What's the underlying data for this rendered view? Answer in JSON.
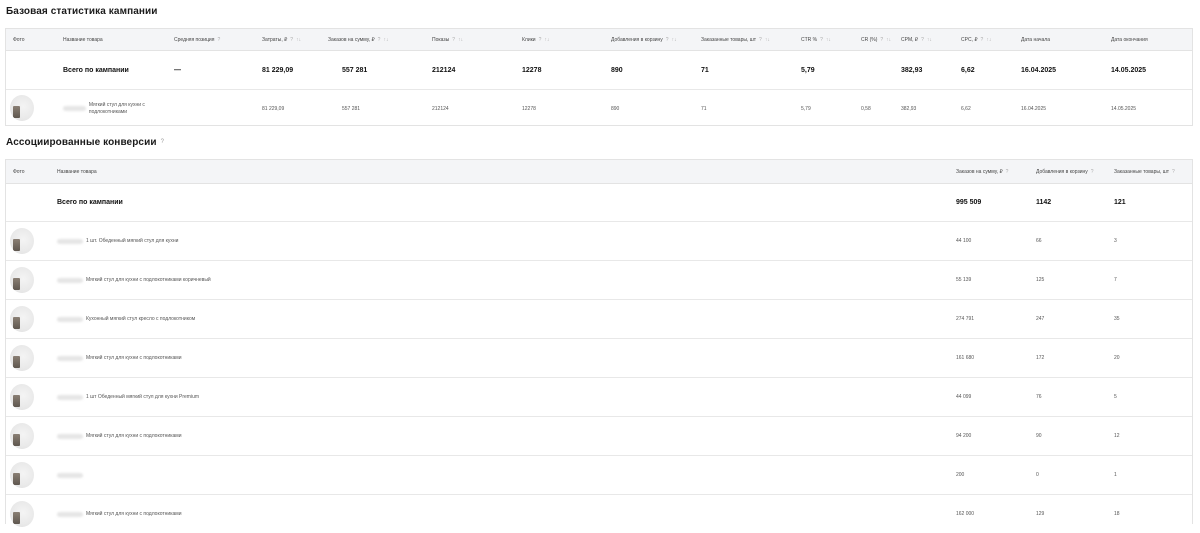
{
  "base": {
    "title": "Базовая статистика кампании",
    "headers": {
      "photo": "Фото",
      "name": "Название товара",
      "avg_pos": "Средняя позиция",
      "cost": "Затраты, ₽",
      "orders_sum": "Заказов на сумму, ₽",
      "shows": "Показы",
      "clicks": "Клики",
      "cart": "Добавления в корзину",
      "ordered": "Заказанные товары, шт",
      "ctr": "CTR %",
      "cr": "CR (%)",
      "cpm": "CPM, ₽",
      "cpc": "CPC, ₽",
      "start": "Дата начала",
      "end": "Дата окончания"
    },
    "total": {
      "name": "Всего по кампании",
      "avg_pos": "—",
      "cost": "81 229,09",
      "orders_sum": "557 281",
      "shows": "212124",
      "clicks": "12278",
      "cart": "890",
      "ordered": "71",
      "ctr": "5,79",
      "cr": "",
      "cpm": "382,93",
      "cpc": "6,62",
      "start": "16.04.2025",
      "end": "14.05.2025"
    },
    "item": {
      "name": "Мягкий стул для кухни с подлокотниками",
      "cost": "81 229,09",
      "orders_sum": "557 281",
      "shows": "212124",
      "clicks": "12278",
      "cart": "890",
      "ordered": "71",
      "ctr": "5,79",
      "cr": "0,58",
      "cpm": "382,93",
      "cpc": "6,62",
      "start": "16.04.2025",
      "end": "14.05.2025"
    }
  },
  "assoc": {
    "title": "Ассоциированные конверсии",
    "headers": {
      "photo": "Фото",
      "name": "Название товара",
      "orders_sum": "Заказов на сумму, ₽",
      "cart": "Добавления в корзину",
      "ordered": "Заказанные товары, шт"
    },
    "total": {
      "name": "Всего по кампании",
      "orders_sum": "995 509",
      "cart": "1142",
      "ordered": "121"
    },
    "rows": [
      {
        "name": "1 шт. Обеденный мягкий стул для кухни",
        "orders_sum": "44 100",
        "cart": "66",
        "ordered": "3"
      },
      {
        "name": "Мягкий стул для кухни с подлокотниками коричневый",
        "orders_sum": "55 139",
        "cart": "125",
        "ordered": "7"
      },
      {
        "name": "Кухонный мягкий стул кресло с подлокотником",
        "orders_sum": "274 791",
        "cart": "247",
        "ordered": "35"
      },
      {
        "name": "Мягкий стул для кухни с подлокотниками",
        "orders_sum": "161 680",
        "cart": "172",
        "ordered": "20"
      },
      {
        "name": "1 шт Обеденный мягкий стул для кухни Premium",
        "orders_sum": "44 099",
        "cart": "76",
        "ordered": "5"
      },
      {
        "name": "Мягкий стул для кухни с подлокотниками",
        "orders_sum": "94 200",
        "cart": "90",
        "ordered": "12"
      },
      {
        "name": "",
        "orders_sum": "200",
        "cart": "0",
        "ordered": "1"
      },
      {
        "name": "Мягкий стул для кухни с подлокотниками",
        "orders_sum": "162 000",
        "cart": "129",
        "ordered": "18"
      }
    ]
  },
  "question_mark": "?",
  "sort_icon": "↑↓"
}
